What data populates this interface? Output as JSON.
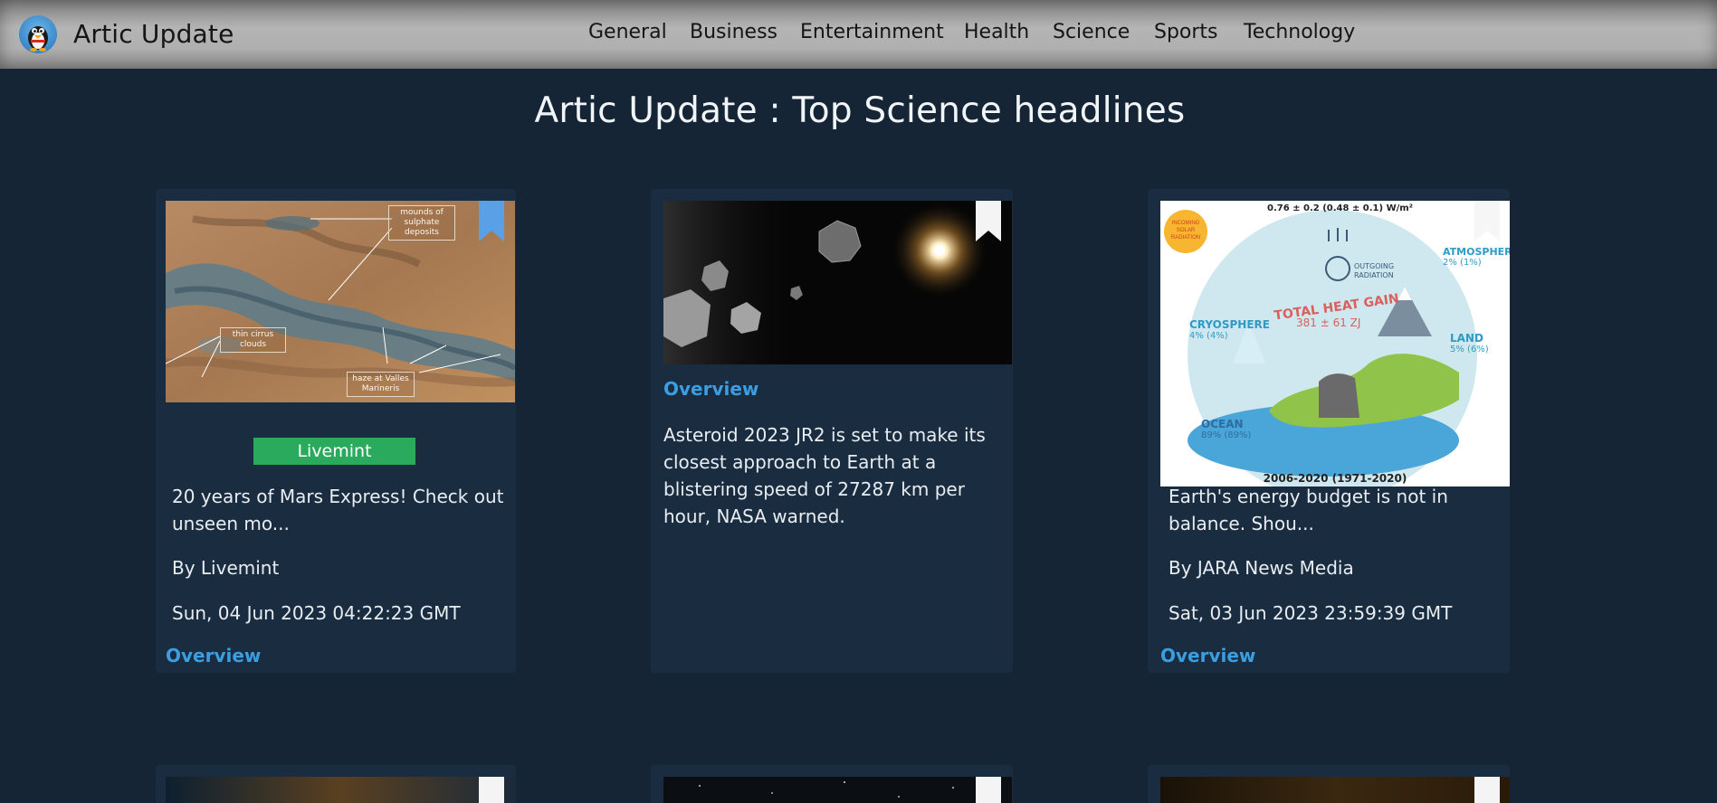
{
  "navbar": {
    "brand": "Artic Update",
    "links": [
      "General",
      "Business",
      "Entertainment",
      "Health",
      "Science",
      "Sports",
      "Technology"
    ]
  },
  "page": {
    "heading": "Artic Update : Top Science headlines"
  },
  "cards": [
    {
      "source_badge": "Livemint",
      "image_labels": [
        "mounds of sulphate deposits",
        "thin cirrus clouds",
        "haze at Valles Marineris"
      ],
      "title": "20 years of Mars Express! Check out unseen mo...",
      "author": "By Livemint",
      "date": "Sun, 04 Jun 2023 04:22:23 GMT",
      "link": "Overview",
      "bookmark_color": "#5aa0e6"
    },
    {
      "link_top": "Overview",
      "description": "Asteroid 2023 JR2 is set to make its closest approach to Earth at a blistering speed of 27287 km per hour, NASA warned.",
      "bookmark_color": "#f4f4f4"
    },
    {
      "image_labels": {
        "top": "0.76 ± 0.2 (0.48 ± 0.1) W/m²",
        "incoming": "INCOMING SOLAR RADIATION",
        "outgoing": "OUTGOING RADIATION",
        "atmosphere": "ATMOSPHERE",
        "atmosphere_pct": "2% (1%)",
        "heat_gain": "TOTAL HEAT GAIN",
        "heat_value": "381 ± 61 ZJ",
        "cryosphere": "CRYOSPHERE",
        "cryosphere_pct": "4% (4%)",
        "land": "LAND",
        "land_pct": "5% (6%)",
        "ocean": "OCEAN",
        "ocean_pct": "89% (89%)",
        "years": "2006-2020 (1971-2020)"
      },
      "title": "Earth's energy budget is not in balance. Shou...",
      "author": "By JARA News Media",
      "date": "Sat, 03 Jun 2023 23:59:39 GMT",
      "link": "Overview",
      "bookmark_color": "#f4f4f4"
    }
  ],
  "colors": {
    "background": "#152536",
    "card": "#1a2c3f",
    "link": "#3b9ee0",
    "badge": "#2aaa5c"
  }
}
